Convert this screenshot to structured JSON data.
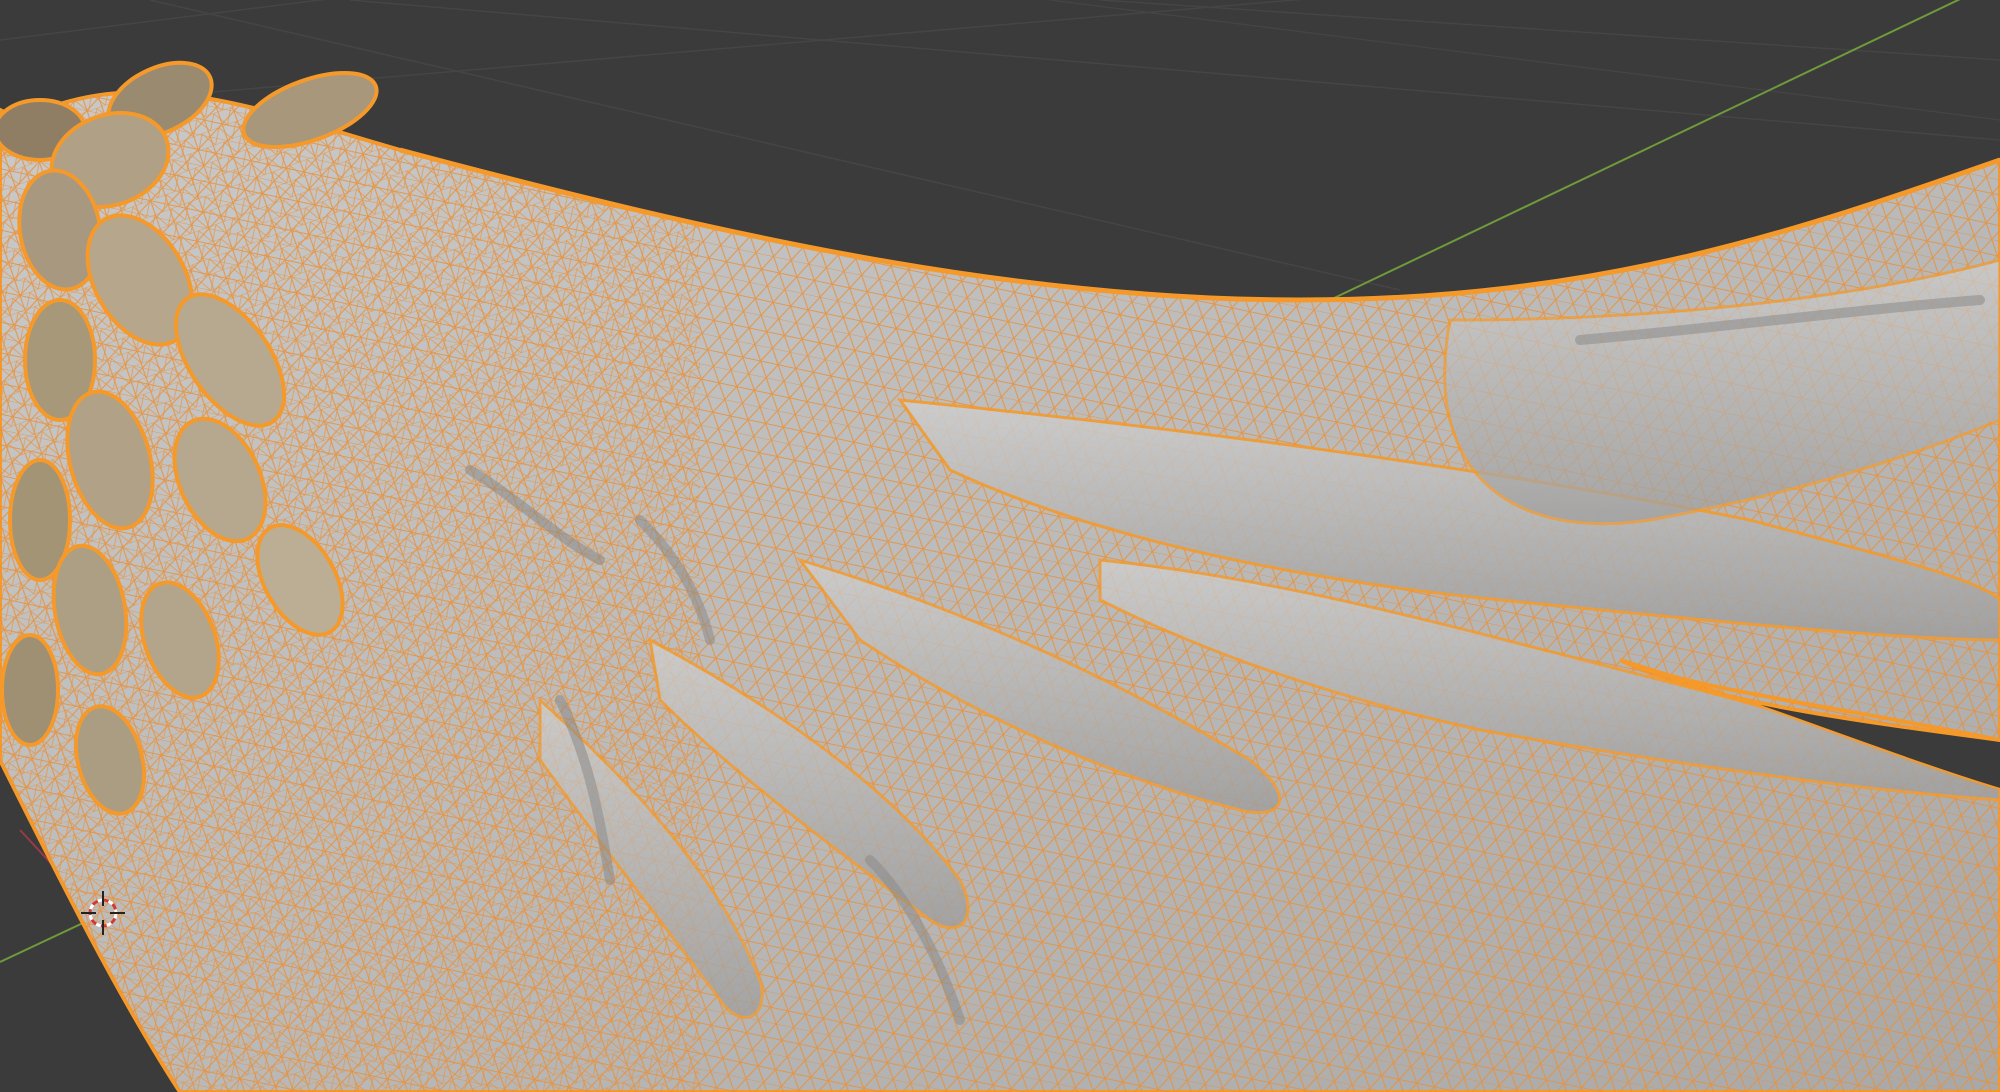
{
  "viewport": {
    "background_color": "#3b3b3b",
    "grid_color": "#4a4a4a",
    "x_axis_color": "#9a3a48",
    "y_axis_color": "#6f9a3c"
  },
  "object": {
    "kind": "wing-mesh",
    "selected": true,
    "shading": "solid-with-wireframe-overlay",
    "surface_color": "#b9b9b9",
    "wire_color": "#e8913a",
    "outline_color": "#f59a2a"
  },
  "cursor": {
    "icon": "3d-cursor-icon"
  }
}
